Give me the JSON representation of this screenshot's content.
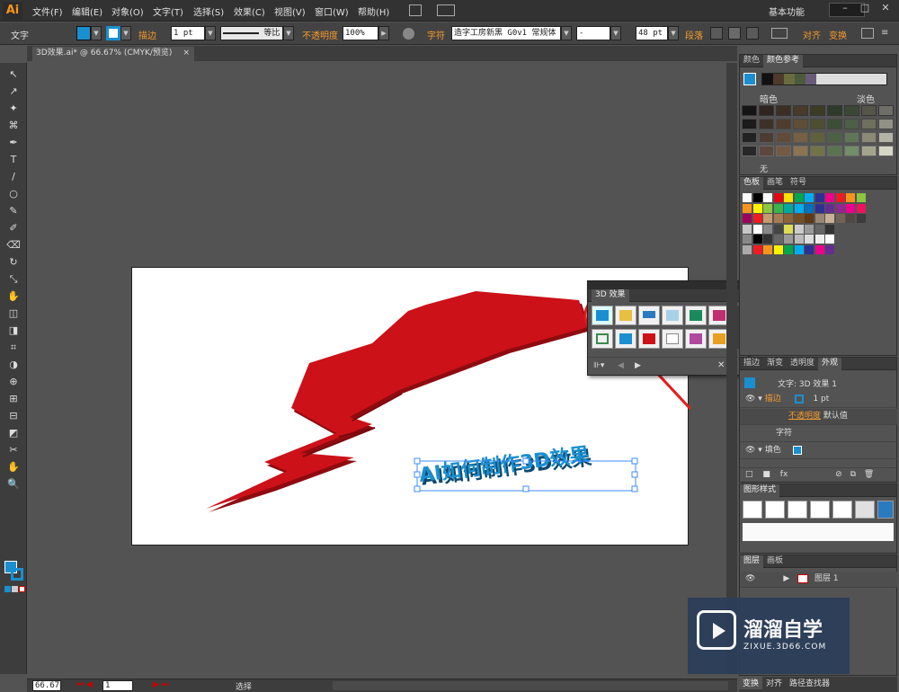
{
  "app": {
    "logo": "Ai"
  },
  "menus": [
    "文件(F)",
    "编辑(E)",
    "对象(O)",
    "文字(T)",
    "选择(S)",
    "效果(C)",
    "视图(V)",
    "窗口(W)",
    "帮助(H)"
  ],
  "workspace": "基本功能",
  "window_controls": {
    "minimize": "–",
    "maximize": "□",
    "close": "✕"
  },
  "control_bar": {
    "type_label": "文字",
    "stroke_link": "描边",
    "stroke_value": "1 pt",
    "stroke_style": "等比",
    "opacity_link": "不透明度",
    "opacity_value": "100%",
    "char_link": "字符",
    "font_name": "造字工房新黑 G0v1 常规体",
    "font_style": "-",
    "font_size": "48 pt",
    "para_link": "段落",
    "align_link": "对齐",
    "transform_link": "变换",
    "fill_color": "#1a8fd0"
  },
  "document_tab": {
    "title": "3D效果.ai* @ 66.67% (CMYK/预览)",
    "close": "×"
  },
  "tools": [
    "↖",
    "↗",
    "✦",
    "⌘",
    "✒",
    "T",
    "/",
    "○",
    "✎",
    "✐",
    "⌫",
    "↻",
    "⤡",
    "✋",
    "◫",
    "◨",
    "⌗",
    "◑",
    "⊕",
    "⊞",
    "⊟",
    "◩",
    "✂",
    "✋",
    "🔍"
  ],
  "canvas": {
    "headline": "AI如何制作3D效果",
    "shape_color": "#cc1118",
    "text_color": "#1a8fd0"
  },
  "status": {
    "zoom": "66.67",
    "page": "1",
    "mode": "选择"
  },
  "color_panel": {
    "tabs": [
      "颜色",
      "颜色参考"
    ],
    "dark_label": "暗色",
    "light_label": "淡色",
    "none_label": "无",
    "harmony": [
      "#111111",
      "#4e3a2c",
      "#6b6b40",
      "#4a5a3a",
      "#6a5a7a"
    ]
  },
  "swatches_panel": {
    "tabs": [
      "色板",
      "画笔",
      "符号"
    ]
  },
  "appearance_panel": {
    "tabs": [
      "描边",
      "渐变",
      "透明度",
      "外观"
    ],
    "title": "文字: 3D 效果 1",
    "rows": [
      {
        "label": "描边",
        "value": "1 pt"
      },
      {
        "label": "不透明度",
        "value": "默认值"
      },
      {
        "label": "字符",
        "value": ""
      },
      {
        "label": "填色",
        "value": ""
      }
    ]
  },
  "graphic_styles_panel": {
    "tab": "图形样式"
  },
  "layers_panel": {
    "tabs": [
      "图层",
      "画板"
    ],
    "layer_name": "图层 1"
  },
  "fx_panel": {
    "title": "3D 效果",
    "controls": "⊲ ⊳ ✕"
  },
  "bottom_tabs": [
    "变换",
    "对齐",
    "路径查找器"
  ],
  "watermark": {
    "title": "溜溜自学",
    "url": "ZIXUE.3D66.COM"
  }
}
